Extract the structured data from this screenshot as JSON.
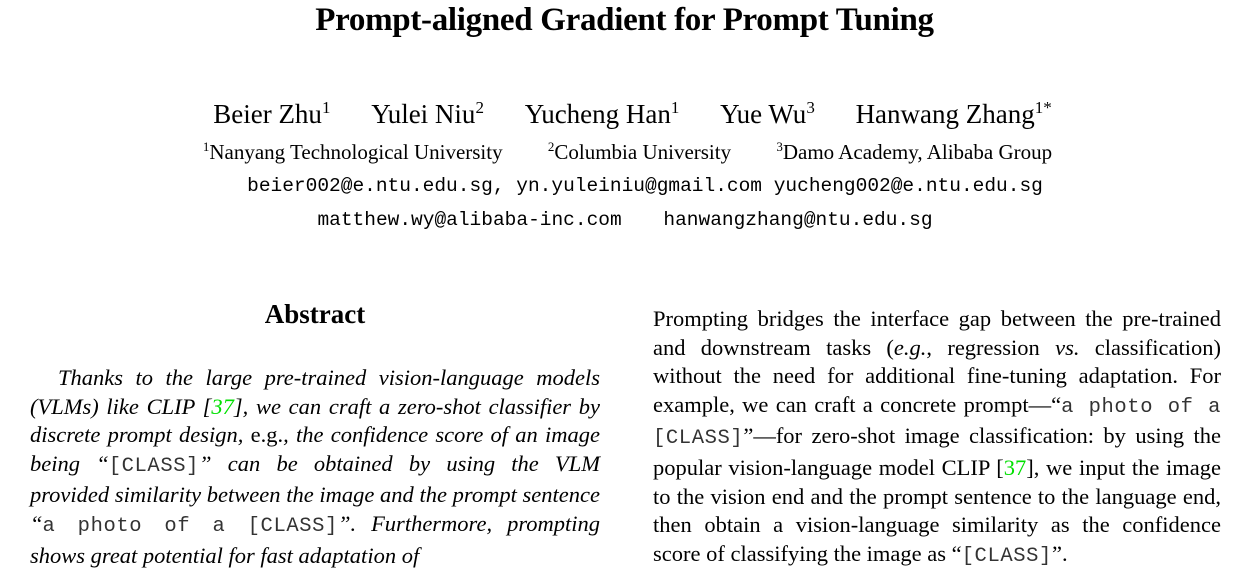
{
  "paper": {
    "title": "Prompt-aligned Gradient for Prompt Tuning",
    "authors": [
      {
        "name": "Beier Zhu",
        "sup": "1"
      },
      {
        "name": "Yulei Niu",
        "sup": "2"
      },
      {
        "name": "Yucheng Han",
        "sup": "1"
      },
      {
        "name": "Yue Wu",
        "sup": "3"
      },
      {
        "name": "Hanwang Zhang",
        "sup": "1*"
      }
    ],
    "affiliations": [
      {
        "sup": "1",
        "name": "Nanyang Technological University"
      },
      {
        "sup": "2",
        "name": "Columbia University"
      },
      {
        "sup": "3",
        "name": "Damo Academy, Alibaba Group"
      }
    ],
    "emails_line1": "beier002@e.ntu.edu.sg, yn.yuleiniu@gmail.com yucheng002@e.ntu.edu.sg",
    "emails_line2": [
      "matthew.wy@alibaba-inc.com",
      "hanwangzhang@ntu.edu.sg"
    ]
  },
  "abstract": {
    "heading": "Abstract",
    "segments": [
      "Thanks to the large pre-trained vision-language models (VLMs) like CLIP [",
      "37",
      "], we can craft a zero-shot classifier by discrete prompt design, ",
      "e.g.",
      ", the confidence score of an image being “",
      "[CLASS]",
      "” can be obtained by using the VLM provided similarity between the image and the prompt sentence “",
      "a photo of a [CLASS]",
      "”. Furthermore, prompting shows great potential for fast adaptation of"
    ]
  },
  "intro_right": {
    "segments": [
      "Prompting bridges the interface gap between the pre-trained and downstream tasks (",
      "e.g.",
      ", regression ",
      "vs.",
      " classification) without the need for additional fine-tuning adaptation. For example, we can craft a concrete prompt—“",
      "a photo of a [CLASS]",
      "”—for zero-shot image classification: by using the popular vision-language model CLIP [",
      "37",
      "], we input the image to the vision end and the prompt sentence to the language end, then obtain a vision-language similarity as the confidence score of classifying the image as “",
      "[CLASS]",
      "”."
    ]
  },
  "colors": {
    "citation": "#00e000",
    "text": "#000000"
  }
}
